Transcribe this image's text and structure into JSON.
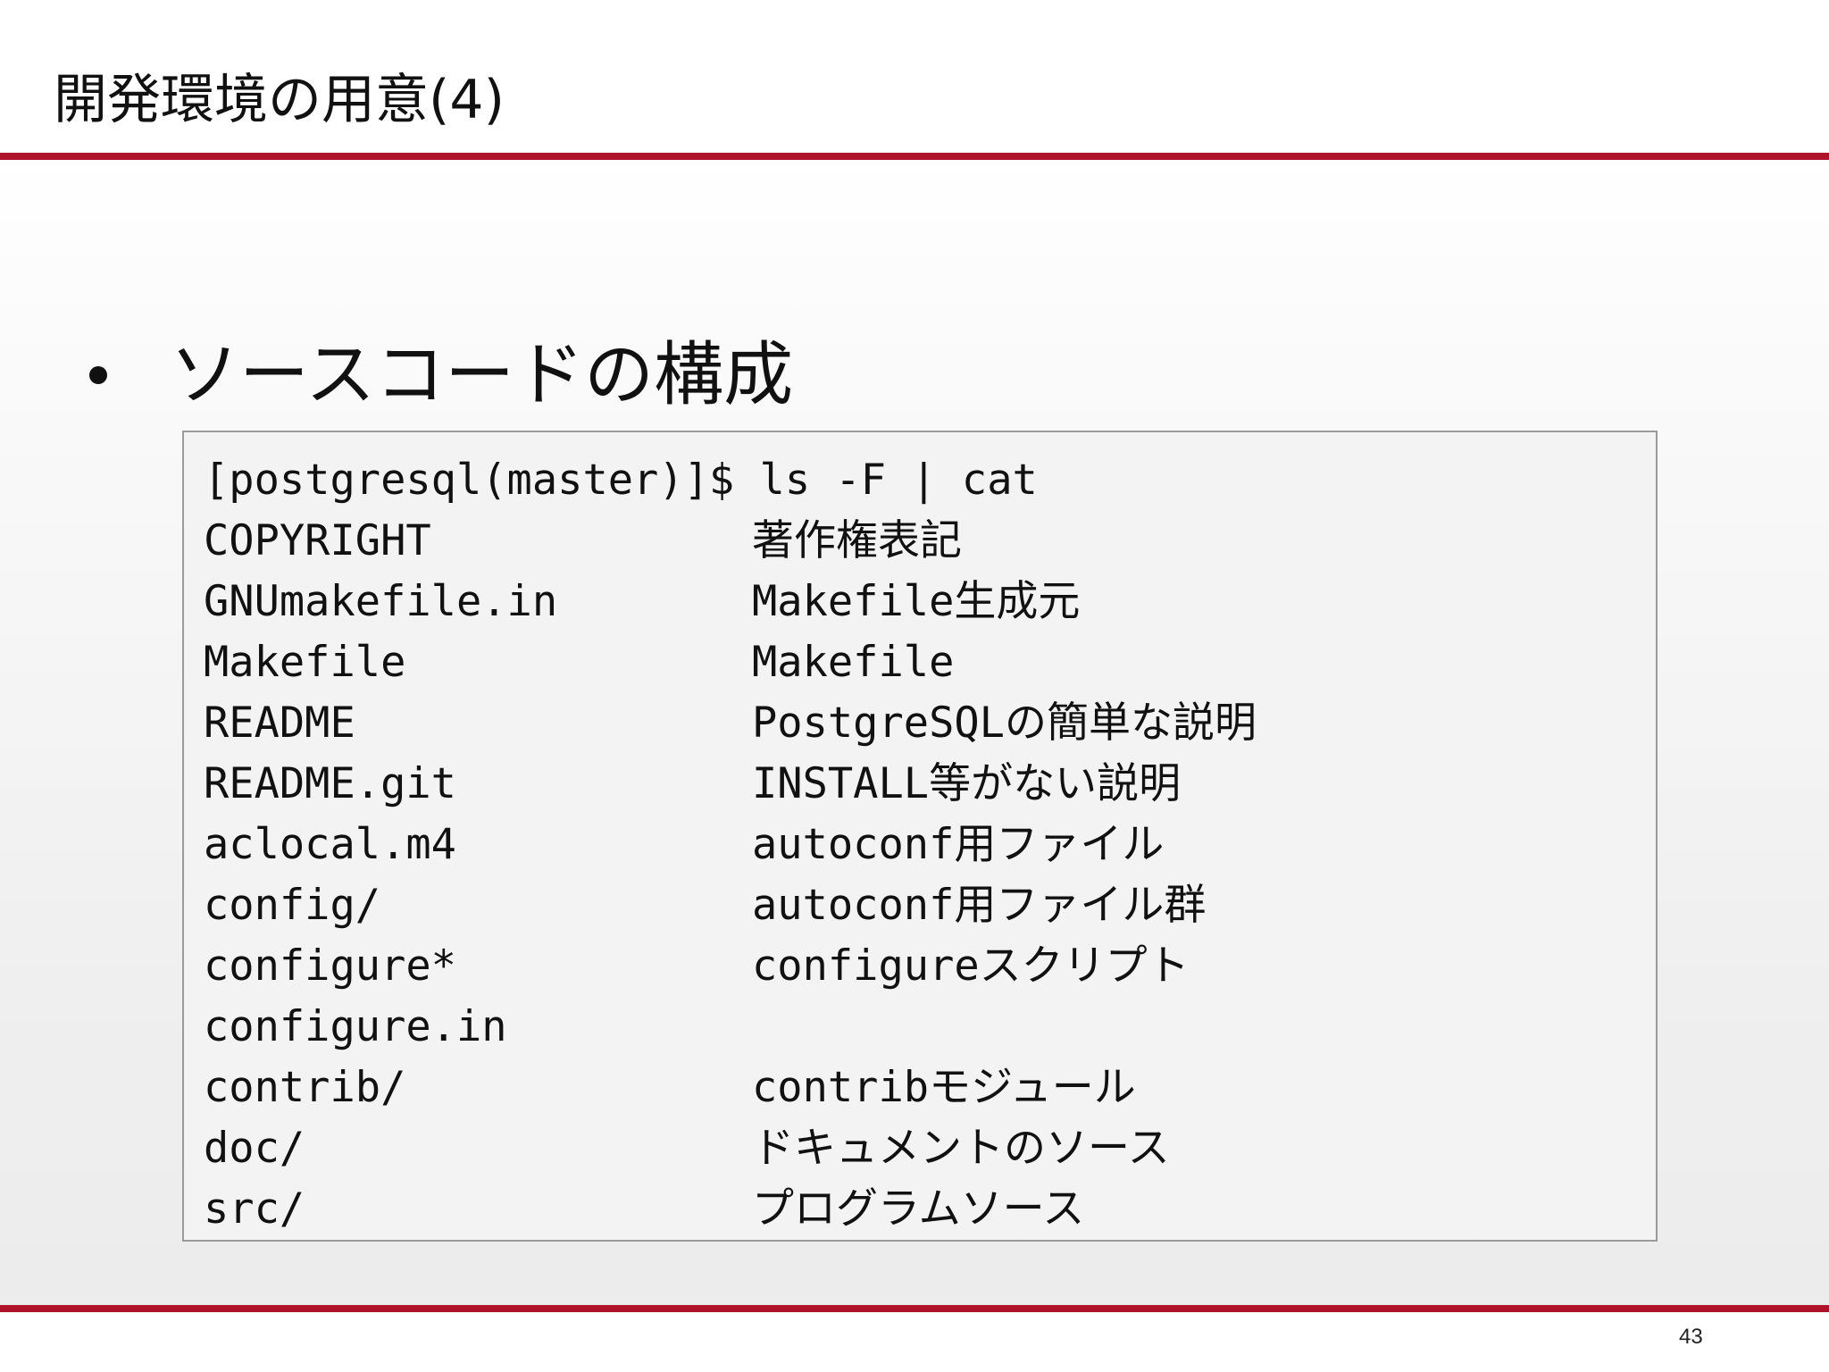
{
  "slide": {
    "title": "開発環境の用意(4)",
    "bullet": "ソースコードの構成",
    "page_number": "43"
  },
  "terminal": {
    "command": "[postgresql(master)]$ ls -F | cat",
    "entries": [
      {
        "name": "COPYRIGHT",
        "description": "著作権表記"
      },
      {
        "name": "GNUmakefile.in",
        "description": "Makefile生成元"
      },
      {
        "name": "Makefile",
        "description": "Makefile"
      },
      {
        "name": "README",
        "description": "PostgreSQLの簡単な説明"
      },
      {
        "name": "README.git",
        "description": "INSTALL等がない説明"
      },
      {
        "name": "aclocal.m4",
        "description": "autoconf用ファイル"
      },
      {
        "name": "config/",
        "description": "autoconf用ファイル群"
      },
      {
        "name": "configure*",
        "description": "configureスクリプト"
      },
      {
        "name": "configure.in",
        "description": ""
      },
      {
        "name": "contrib/",
        "description": "contribモジュール"
      },
      {
        "name": "doc/",
        "description": "ドキュメントのソース"
      },
      {
        "name": "src/",
        "description": "プログラムソース"
      }
    ]
  },
  "colors": {
    "accent_rule": "#b0142b",
    "text": "#111111",
    "terminal_background": "#f3f3f3",
    "terminal_border": "#9a9a9a"
  }
}
